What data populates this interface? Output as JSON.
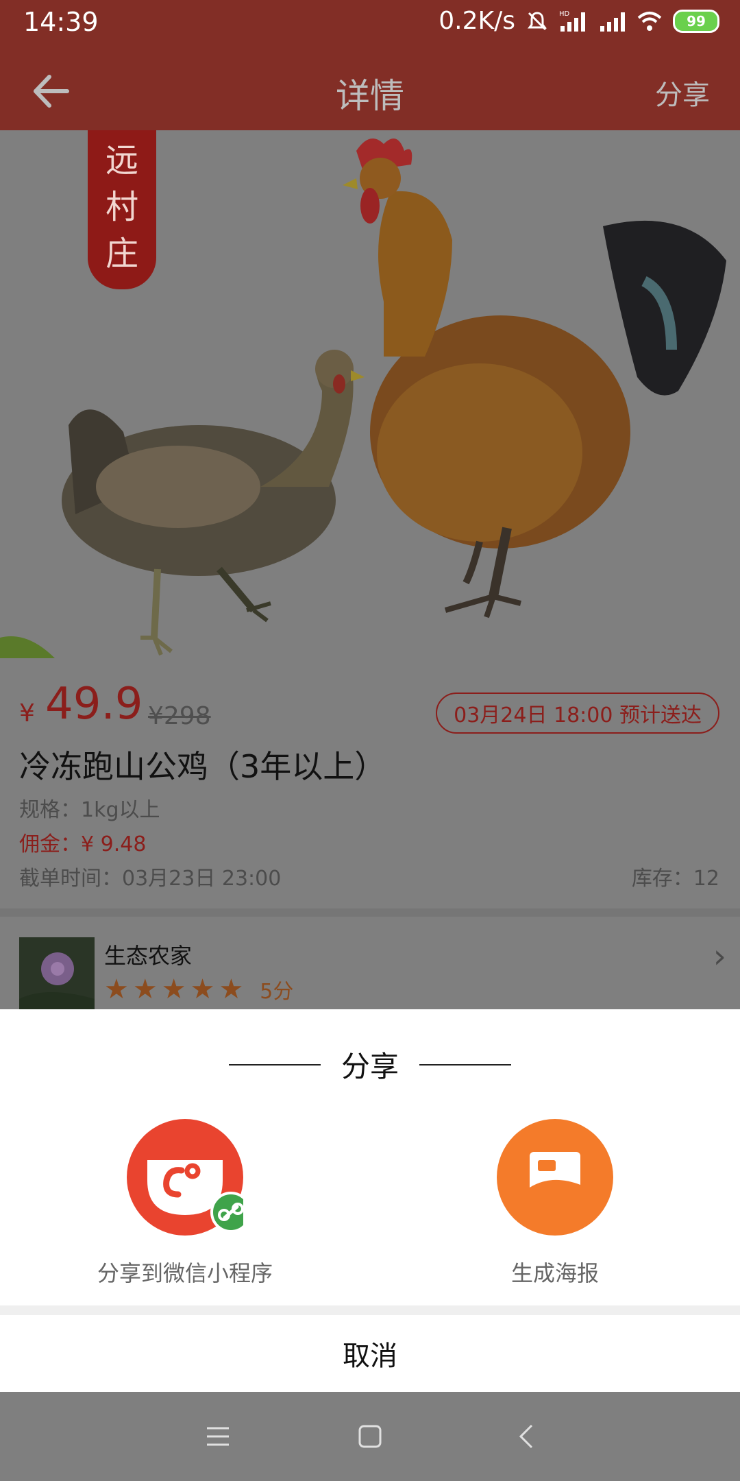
{
  "status_bar": {
    "time": "14:39",
    "net_speed": "0.2K/s",
    "battery": "99"
  },
  "header": {
    "title": "详情",
    "share_label": "分享"
  },
  "hero": {
    "brand_text": [
      "远",
      "村",
      "庄"
    ]
  },
  "product": {
    "currency": "¥",
    "price": "49.9",
    "original_price": "¥298",
    "delivery": "03月24日 18:00 预计送达",
    "title": "冷冻跑山公鸡（3年以上）",
    "spec": "规格：1kg以上",
    "commission": "佣金：¥ 9.48",
    "cutoff": "截单时间：03月23日 23:00",
    "stock": "库存：12"
  },
  "seller": {
    "name": "生态农家",
    "rating": 5,
    "score_label": "5分"
  },
  "share_sheet": {
    "title": "分享",
    "options": [
      {
        "label": "分享到微信小程序",
        "icon": "wechat-miniprogram-icon",
        "color": "#e9442f"
      },
      {
        "label": "生成海报",
        "icon": "poster-icon",
        "color": "#f47b2a"
      }
    ],
    "cancel_label": "取消"
  },
  "colors": {
    "header_bg": "#822e26",
    "accent_red": "#8b1e1b",
    "star": "#8c4c1e"
  }
}
